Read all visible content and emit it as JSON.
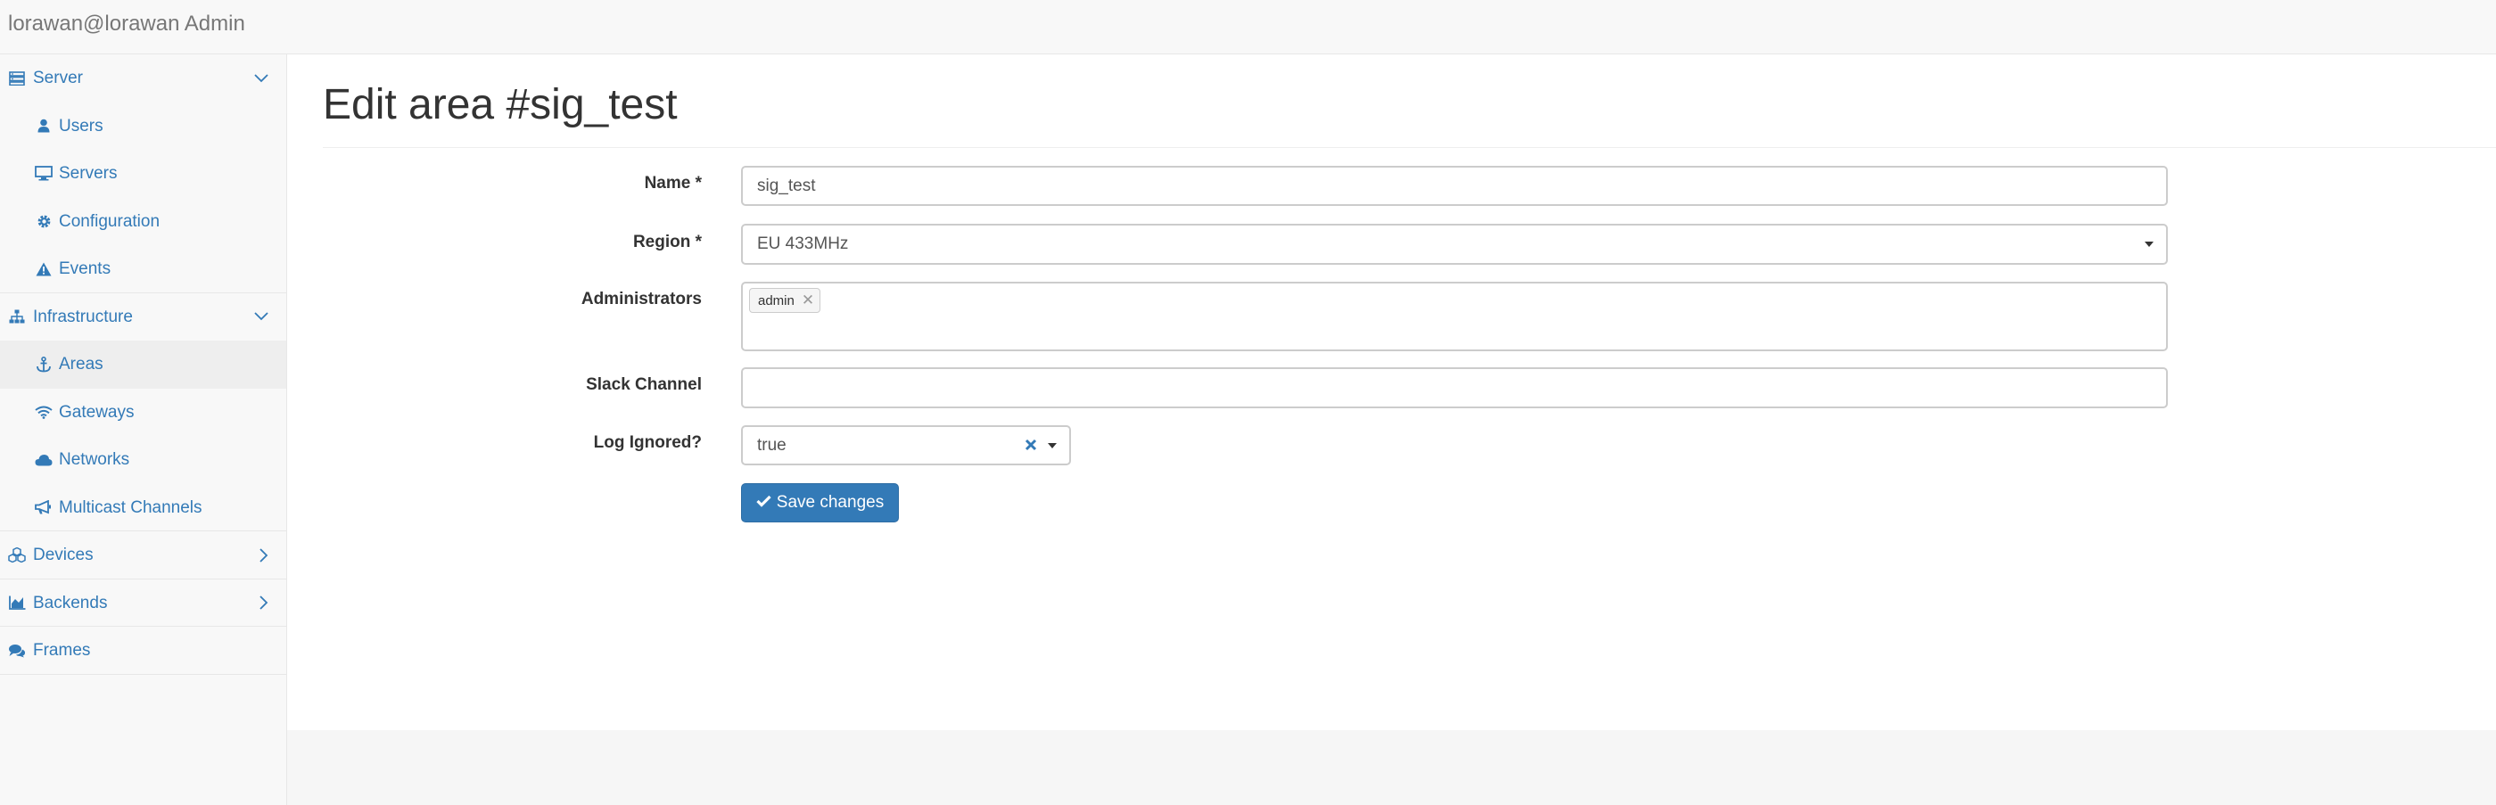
{
  "header": {
    "brand": "lorawan@lorawan Admin"
  },
  "sidebar": {
    "groups": [
      {
        "label": "Server",
        "items": [
          {
            "label": "Users"
          },
          {
            "label": "Servers"
          },
          {
            "label": "Configuration"
          },
          {
            "label": "Events"
          }
        ]
      },
      {
        "label": "Infrastructure",
        "items": [
          {
            "label": "Areas"
          },
          {
            "label": "Gateways"
          },
          {
            "label": "Networks"
          },
          {
            "label": "Multicast Channels"
          }
        ]
      },
      {
        "label": "Devices"
      },
      {
        "label": "Backends"
      },
      {
        "label": "Frames"
      }
    ],
    "active_item": "Areas"
  },
  "page": {
    "title": "Edit area #sig_test"
  },
  "form": {
    "name": {
      "label": "Name *",
      "value": "sig_test"
    },
    "region": {
      "label": "Region *",
      "value": "EU 433MHz"
    },
    "administrators": {
      "label": "Administrators",
      "tags": [
        "admin"
      ]
    },
    "slack_channel": {
      "label": "Slack Channel",
      "value": ""
    },
    "log_ignored": {
      "label": "Log Ignored?",
      "value": "true"
    },
    "save_label": "Save changes"
  },
  "colors": {
    "link": "#337ab7",
    "button": "#337ab7"
  }
}
